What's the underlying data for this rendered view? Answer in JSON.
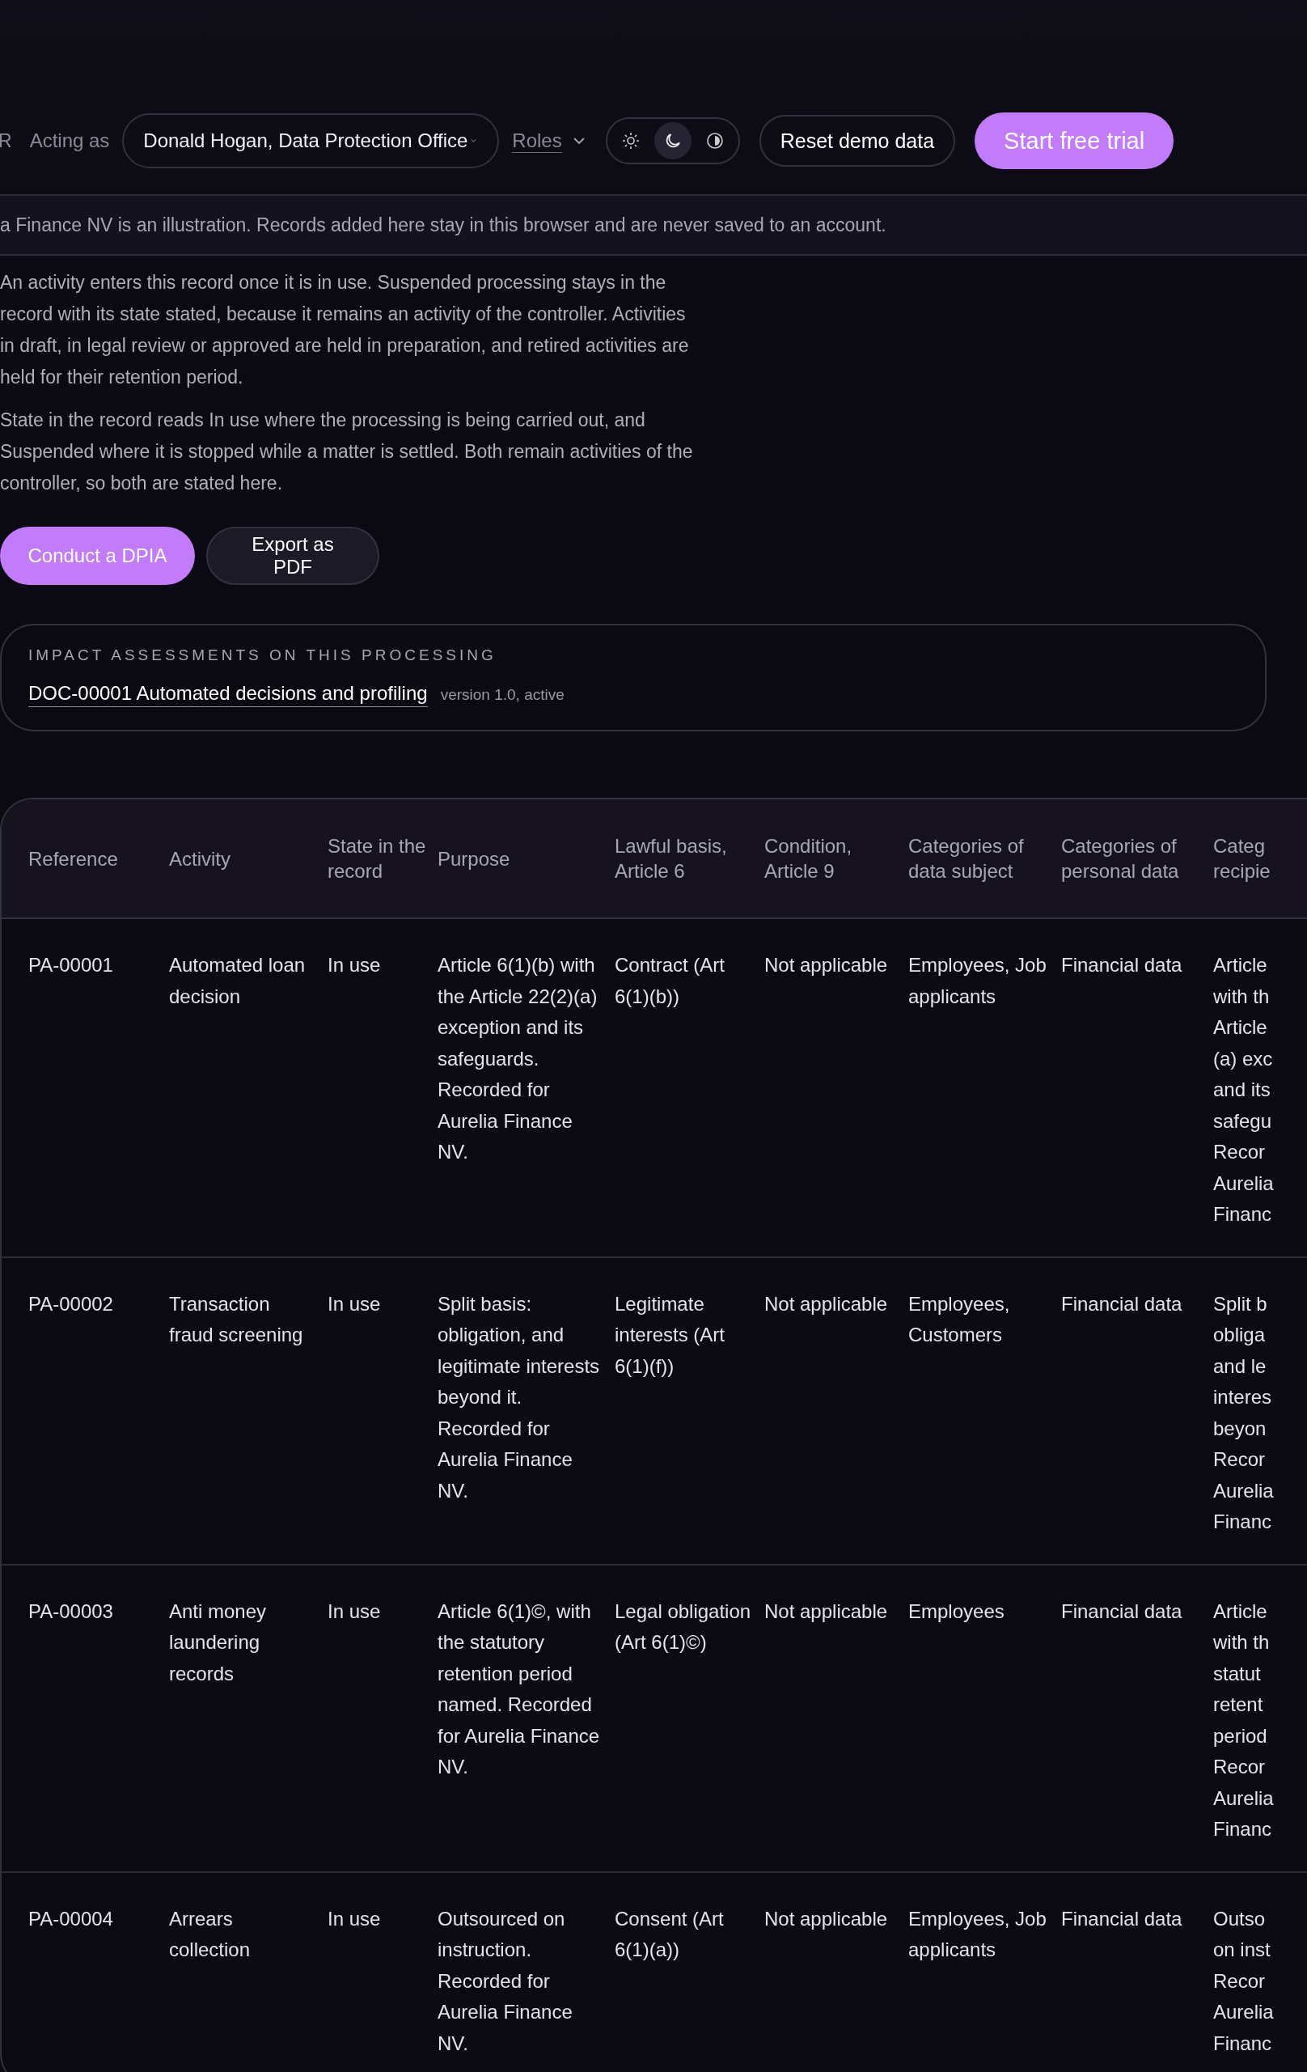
{
  "topbar": {
    "cut_label": "R",
    "acting_as_label": "Acting as",
    "acting_as_value": "Donald Hogan, Data Protection Office",
    "roles_label": "Roles",
    "theme_options": [
      {
        "kind": "light",
        "selected": false
      },
      {
        "kind": "dark",
        "selected": true
      },
      {
        "kind": "contrast",
        "selected": false
      }
    ],
    "reset_button": "Reset demo data",
    "trial_button": "Start free trial"
  },
  "banner": "a Finance NV is an illustration. Records added here stay in this browser and are never saved to an account.",
  "paragraphs": [
    "An activity enters this record once it is in use. Suspended processing stays in the record with its state stated, because it remains an activity of the controller. Activities in draft, in legal review or approved are held in preparation, and retired activities are held for their retention period.",
    "State in the record reads In use where the processing is being carried out, and Suspended where it is stopped while a matter is settled. Both remain activities of the controller, so both are stated here."
  ],
  "actions": [
    {
      "kind": "primary",
      "label": "Conduct a DPIA"
    },
    {
      "kind": "secondary",
      "label": "Export as PDF"
    }
  ],
  "impact_card": {
    "title": "IMPACT ASSESSMENTS ON THIS PROCESSING",
    "link": "DOC-00001 Automated decisions and profiling",
    "meta": "version 1.0, active"
  },
  "table": {
    "columns": [
      "Reference",
      "Activity",
      "State in the record",
      "Purpose",
      "Lawful basis, Article 6",
      "Condition, Article 9",
      "Categories of data subject",
      "Categories of personal data",
      "Categ\nrecipie"
    ],
    "rows": [
      [
        "PA-00001",
        "Automated loan decision",
        "In use",
        "Article 6(1)(b) with the Article 22(2)(a) exception and its safeguards. Recorded for Aurelia Finance NV.",
        "Contract (Art 6(1)(b))",
        "Not applicable",
        "Employees, Job applicants",
        "Financial data",
        "Article\nwith th\nArticle\n(a) exc\nand its\nsafegu\nRecor\nAurelia\nFinanc"
      ],
      [
        "PA-00002",
        "Transaction fraud screening",
        "In use",
        "Split basis: obligation, and legitimate interests beyond it. Recorded for Aurelia Finance NV.",
        "Legitimate interests (Art 6(1)(f))",
        "Not applicable",
        "Employees, Customers",
        "Financial data",
        "Split b\nobliga\nand le\ninteres\nbeyon\nRecor\nAurelia\nFinanc"
      ],
      [
        "PA-00003",
        "Anti money laundering records",
        "In use",
        "Article 6(1)©, with the statutory retention period named. Recorded for Aurelia Finance NV.",
        "Legal obligation (Art 6(1)©)",
        "Not applicable",
        "Employees",
        "Financial data",
        "Article\nwith th\nstatut\nretent\nperiod\nRecor\nAurelia\nFinanc"
      ],
      [
        "PA-00004",
        "Arrears collection",
        "In use",
        "Outsourced on instruction. Recorded for Aurelia Finance NV.",
        "Consent (Art 6(1)(a))",
        "Not applicable",
        "Employees, Job applicants",
        "Financial data",
        "Outso\non inst\nRecor\nAurelia\nFinanc"
      ]
    ]
  }
}
